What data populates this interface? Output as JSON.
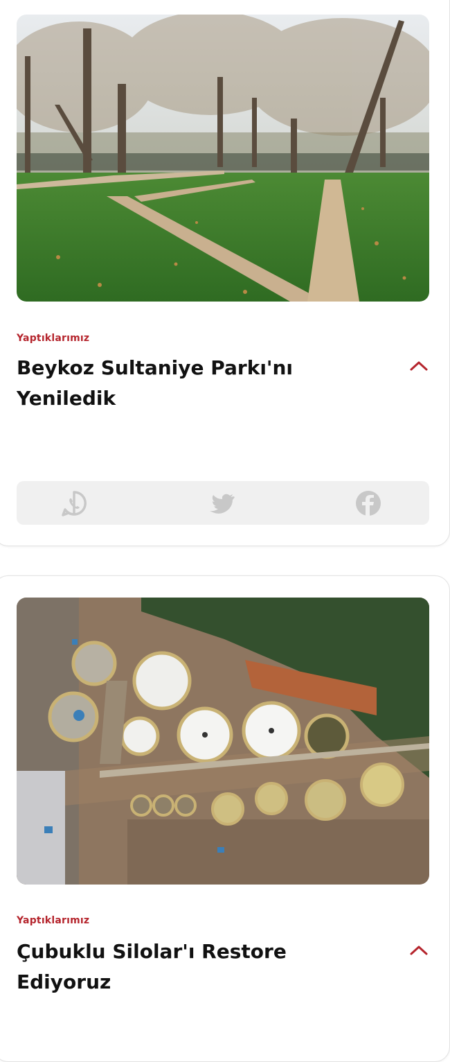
{
  "cards": [
    {
      "image_alt": "Park with plane trees, green lawn and concrete walkway",
      "category": "Yaptıklarımız",
      "title": "Beykoz Sultaniye Parkı'nı Yeniledik",
      "share": {
        "icons": [
          "whatsapp-icon",
          "twitter-icon",
          "facebook-icon"
        ]
      }
    },
    {
      "image_alt": "Aerial view of silo tanks on a construction site",
      "category": "Yaptıklarımız",
      "title": "Çubuklu Silolar'ı Restore Ediyoruz"
    }
  ],
  "colors": {
    "accent": "#b5252d",
    "share_bg": "#f0f0f0",
    "icon": "#c8c8c8"
  }
}
